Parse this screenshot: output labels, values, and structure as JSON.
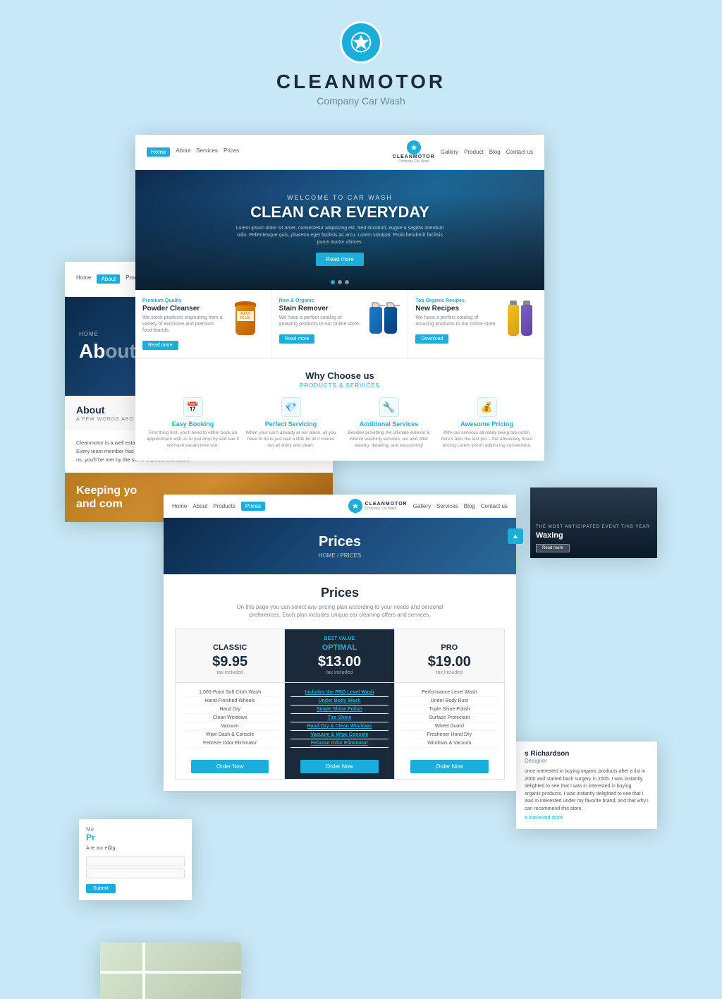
{
  "site": {
    "brand": "CLEANMOTOR",
    "tagline": "Company Car Wash"
  },
  "nav": {
    "links": [
      "Home",
      "About",
      "Services",
      "Prices"
    ],
    "links_right": [
      "Gallery",
      "Product",
      "Blog",
      "Contact us"
    ],
    "active": "Home",
    "logo_mini": "CLEANM",
    "logo_sub": "Car Wash"
  },
  "hero": {
    "pre_title": "WELCOME TO CAR WASH",
    "title": "CLEAN CAR EVERYDAY",
    "description": "Lorem ipsum dolor sit amet, consectetur adipiscing elit. Sed tincidunt, augue a sagittis interdum odio. Pellentesque quis, pharetra eget facilisis ac arcu. Lorem volutpat. Proin hendrerit facilisis purus auctor ultrices.",
    "cta": "Read more",
    "dots": 3,
    "active_dot": 1
  },
  "products": [
    {
      "badge": "Premium Quality",
      "name": "Powder Cleanser",
      "description": "We stock products originating from a variety of exclusive and premium food brands.",
      "button": "Read more"
    },
    {
      "badge": "New & Organic",
      "name": "Stain Remover",
      "description": "We have a perfect catalog of amazing products to our online store.",
      "button": "Read more"
    },
    {
      "badge": "Top Organic Recipes",
      "name": "New Recipes",
      "description": "We have a perfect catalog of amazing products to our online store.",
      "button": "Download"
    }
  ],
  "why_choose": {
    "title": "Why Choose us",
    "subtitle": "PRODUCTS & SERVICES",
    "items": [
      {
        "icon": "📅",
        "title": "Easy Booking",
        "desc": "First thing first, you'll need to either book an appointment with us or just drop by and see if we have vacant time slot."
      },
      {
        "icon": "💎",
        "title": "Perfect Servicing",
        "desc": "When your car's already at our place, all you have to do is just wait a little bit till it comes out all shiny and clean."
      },
      {
        "icon": "🔧",
        "title": "Additional Services",
        "desc": "Besides providing the ultimate exterior & interior washing services, we also offer waxing, detailing, and vacuuming!"
      },
      {
        "icon": "💰",
        "title": "Awesome Pricing",
        "desc": "With our services all ready being top-notch, here's also the last pro – the absolutely finest pricing Lorem ipsum adipiscing consectetur."
      }
    ]
  },
  "about": {
    "nav_active": "About",
    "hero_title": "Ab",
    "breadcrumb": "HOME",
    "section_title": "About",
    "section_subtitle": "A FEW WORDS ABO",
    "body": "Cleanmotor is a well established car-cleaning business offering you a great service to look after your car. Every team member has been fully trained in car-cleaning to an extremely high level. Every time you visit us, you'll be met by the same experienced team.",
    "keeping_text": "Keeping yo and com"
  },
  "prices_card": {
    "nav_active": "Prices",
    "hero_title": "Prices",
    "breadcrumb": "HOME / PRICES",
    "section_title": "Prices",
    "section_desc": "On this page you can select any pricing plan according to your needs and personal preferences. Each plan includes unique car cleaning offers and services.",
    "plans": [
      {
        "name": "CLASSIC",
        "price": "$9.95",
        "note": "tax included",
        "best_value": "",
        "optimal": false,
        "features": [
          "1,000-Point Soft Cloth Wash",
          "Hand-Finished Wheels",
          "Hand Dry",
          "Clean Windows",
          "Vacuum",
          "Wipe Dash & Console",
          "Febreze Odor Eliminator"
        ],
        "highlighted": [],
        "button": "Order Now"
      },
      {
        "name": "OPTIMAL",
        "price": "$13.00",
        "note": "tax included",
        "best_value": "BEST VALUE",
        "optimal": true,
        "features": [
          "Includes the PRO Level Wash",
          "Under Body Wash",
          "Single Shine Polish",
          "Tire Shine",
          "Hand Dry & Clean Windows",
          "Vacuum & Wipe Console",
          "Febreze Odor Eliminator"
        ],
        "highlighted": [
          0,
          1,
          2,
          3,
          4,
          5,
          6
        ],
        "button": "Order Now"
      },
      {
        "name": "PRO",
        "price": "$19.00",
        "note": "tax included",
        "best_value": "",
        "optimal": false,
        "features": [
          "Performance Level Wash",
          "Under Body Rust",
          "Triple Shine Polish",
          "Surface Protectant",
          "Wheel Guard",
          "Freshener Hand Dry",
          "Windows & Vacuum"
        ],
        "highlighted": [],
        "button": "Order Now"
      }
    ]
  },
  "waxing": {
    "subtitle": "THE MOST ANTICIPATED EVENT THIS YEAR",
    "title": "Waxing",
    "button": "Read more"
  },
  "profile": {
    "name": "s Richardson",
    "role": "Designer",
    "desc": "once interested in buying organic products after a list in 2000 and started back surgery in 2005. I was instantly delighted to see that I was in interested in buying organic products. I was instantly delighted to see that I was in interested under my favorite brand, and that why I can recommend this store.",
    "link": "e interested store"
  },
  "product_small": {
    "title": "Pr",
    "pre_title": "Me",
    "desc": "A re our e@g"
  },
  "testimonial": {
    "name": "s Richardson",
    "role": "Designer",
    "text": "once interested in buying organic products after a list in 2000 and started back surgery in 2005. I was instantly delighted to see that I was interested in buying organic products I was instantly delighted to see that I was interested under my favorite brand, and that why I can recommend this store."
  }
}
